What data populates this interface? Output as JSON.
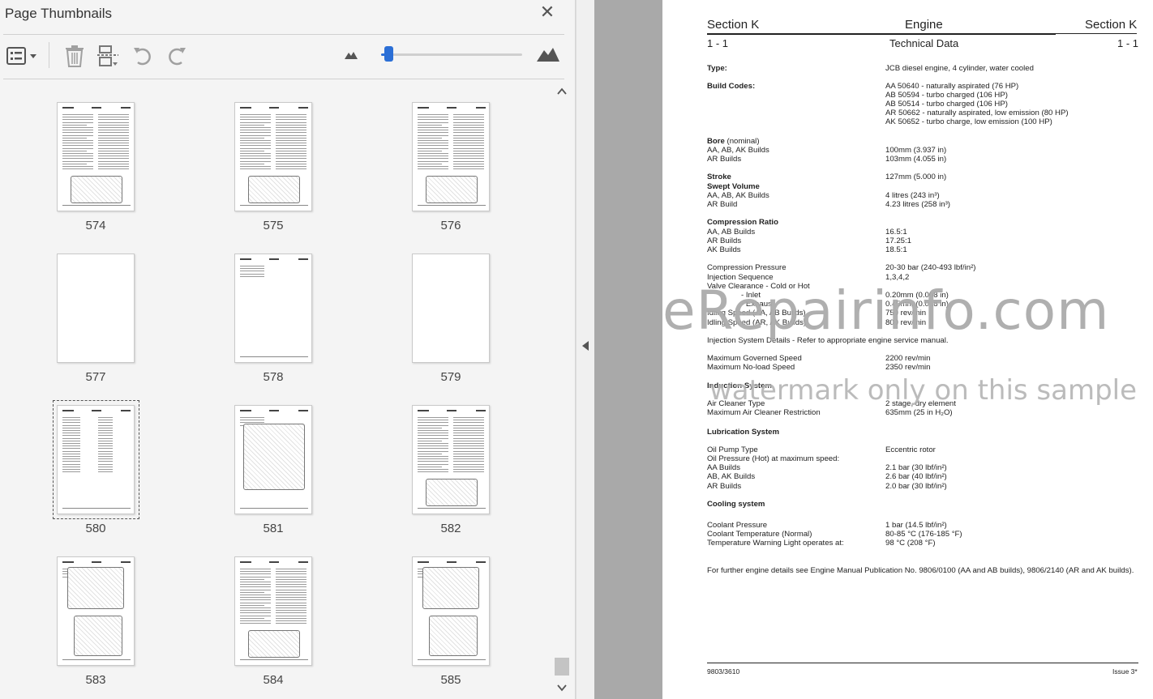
{
  "panel": {
    "title": "Page Thumbnails",
    "close_icon": "close-icon",
    "toolbar": {
      "icons": [
        "thumbnail-options-icon",
        "delete-icon",
        "extract-pages-icon",
        "rotate-counterclockwise-icon",
        "rotate-clockwise-icon"
      ],
      "zoom_level": 0.05
    },
    "thumbnails": [
      {
        "page": "574"
      },
      {
        "page": "575"
      },
      {
        "page": "576"
      },
      {
        "page": "577"
      },
      {
        "page": "578"
      },
      {
        "page": "579"
      },
      {
        "page": "580",
        "selected": true
      },
      {
        "page": "581"
      },
      {
        "page": "582"
      },
      {
        "page": "583"
      },
      {
        "page": "584"
      },
      {
        "page": "585"
      }
    ]
  },
  "document": {
    "header": {
      "section_left": "Section K",
      "chapter": "Engine",
      "section_right": "Section K",
      "page_left": "1 - 1",
      "subtitle": "Technical Data",
      "page_right": "1 - 1"
    },
    "rows": [
      {
        "label": "Type:",
        "value": "JCB diesel engine, 4 cylinder, water cooled",
        "bold": true
      },
      {
        "label": "Build Codes:",
        "value": "AA 50640 - naturally aspirated (76 HP)",
        "bold": true
      },
      {
        "label": "",
        "value": "AB 50594 - turbo charged (106 HP)"
      },
      {
        "label": "",
        "value": "AB 50514 - turbo charged (106 HP)"
      },
      {
        "label": "",
        "value": "AR 50662 - naturally aspirated, low emission (80 HP)"
      },
      {
        "label": "",
        "value": "AK 50652 - turbo charge, low emission (100 HP)"
      },
      {
        "label": "Bore",
        "label_suffix": " (nominal)",
        "value": "",
        "bold": true
      },
      {
        "label": "AA, AB, AK Builds",
        "value": "100mm (3.937 in)"
      },
      {
        "label": "AR Builds",
        "value": "103mm (4.055 in)"
      },
      {
        "label": "Stroke",
        "value": "127mm (5.000 in)",
        "bold": true
      },
      {
        "label": "Swept Volume",
        "value": "",
        "bold": true
      },
      {
        "label": "AA, AB, AK Builds",
        "value": "4 litres (243 in³)"
      },
      {
        "label": "AR Build",
        "value": "4.23 litres (258 in³)"
      },
      {
        "label": "Compression Ratio",
        "value": "",
        "bold": true
      },
      {
        "label": "AA, AB Builds",
        "value": "16.5:1"
      },
      {
        "label": "AR Builds",
        "value": "17.25:1"
      },
      {
        "label": "AK Builds",
        "value": "18.5:1"
      },
      {
        "label": "Compression Pressure",
        "value": "20-30 bar (240-493 lbf/in²)"
      },
      {
        "label": "Injection Sequence",
        "value": "1,3,4,2"
      },
      {
        "label": "Valve Clearance - Cold or Hot",
        "value": ""
      },
      {
        "label": "- Inlet",
        "value": "0.20mm (0.008 in)",
        "indent": true
      },
      {
        "label": "- Exhaust",
        "value": "0.45mm (0.018 in)",
        "indent": true
      },
      {
        "label": "Idling Speed (AA, AB Builds)",
        "value": "750 rev/min"
      },
      {
        "label": "Idling Speed (AR, AK Builds)",
        "value": "800 rev/min"
      },
      {
        "label": "Injection System Details - Refer to  appropriate engine service manual.",
        "value": ""
      },
      {
        "label": "Maximum Governed Speed",
        "value": "2200 rev/min"
      },
      {
        "label": "Maximum No-load Speed",
        "value": "2350 rev/min"
      },
      {
        "label": "Induction System",
        "value": "",
        "bold": true
      },
      {
        "label": "Air Cleaner Type",
        "value": "2 stage, dry element"
      },
      {
        "label": "Maximum Air Cleaner Restriction",
        "value": "635mm (25 in H₂O)"
      },
      {
        "label": "Lubrication System",
        "value": "",
        "bold": true
      },
      {
        "label": "Oil Pump Type",
        "value": "Eccentric rotor"
      },
      {
        "label": "Oil Pressure (Hot) at maximum speed:",
        "value": ""
      },
      {
        "label": "AA Builds",
        "value": "2.1 bar (30 lbf/in²)"
      },
      {
        "label": "AB, AK Builds",
        "value": "2.6 bar (40 lbf/in²)"
      },
      {
        "label": "AR Builds",
        "value": "2.0 bar (30 lbf/in²)"
      },
      {
        "label": "Cooling system",
        "value": "",
        "bold": true
      },
      {
        "label": "Coolant Pressure",
        "value": "1 bar (14.5 lbf/in²)"
      },
      {
        "label": "Coolant Temperature (Normal)",
        "value": "80-85 °C (176-185 °F)"
      },
      {
        "label": "Temperature Warning Light operates at:",
        "value": "98 °C (208 °F)"
      },
      {
        "label": "For further engine details see Engine Manual Publication No. 9806/0100 (AA and AB builds), 9806/2140 (AR and AK builds).",
        "value": ""
      }
    ],
    "footer": {
      "left": "9803/3610",
      "right": "Issue 3*"
    },
    "watermark": {
      "main": "eRepairinfo.com",
      "sub": "watermark only on this sample"
    }
  }
}
